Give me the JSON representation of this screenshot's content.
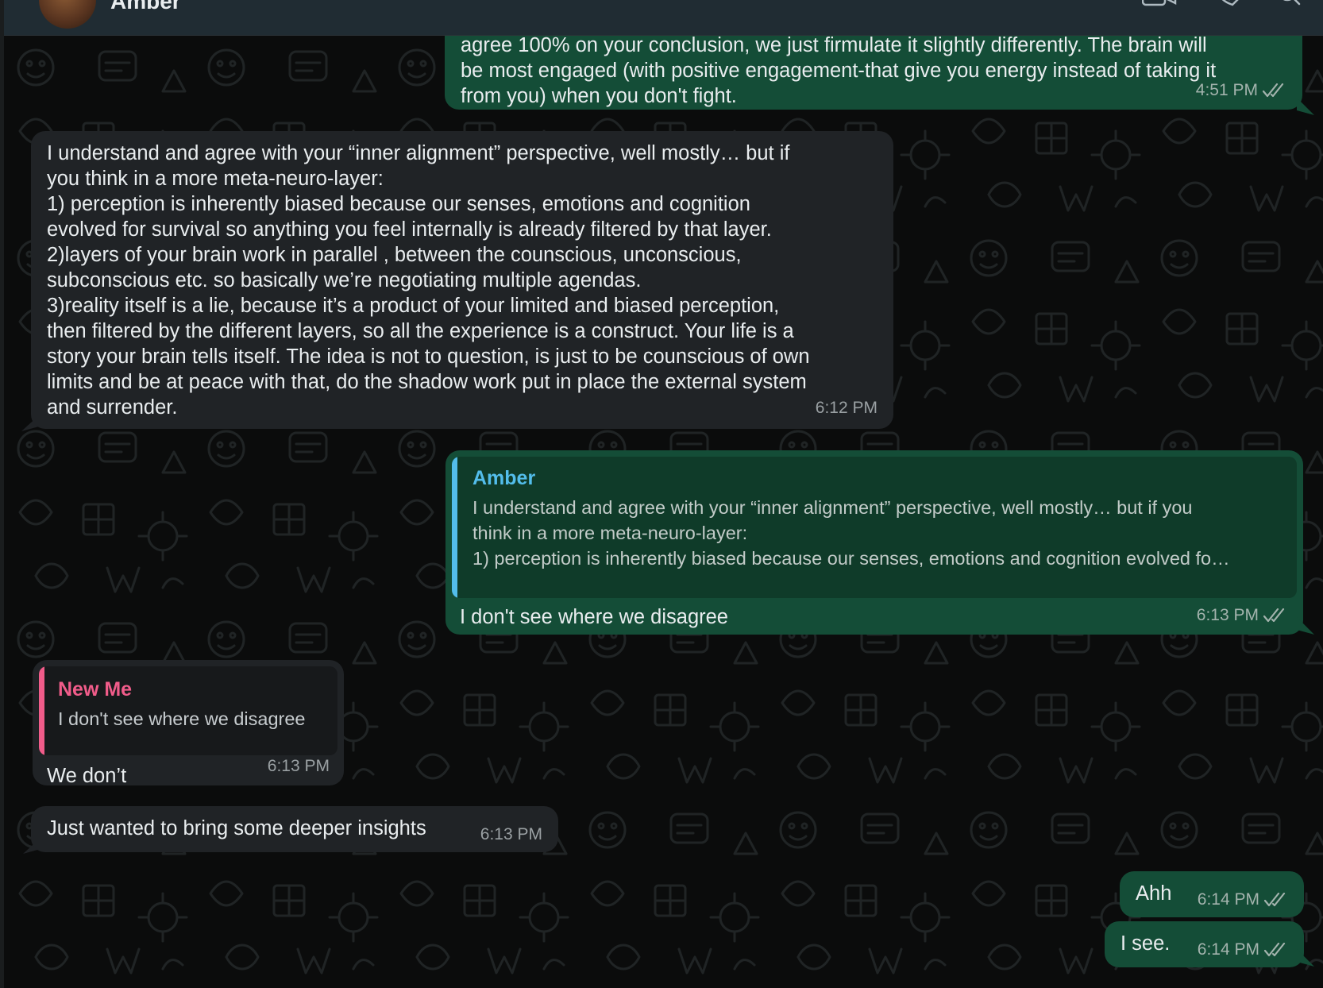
{
  "header": {
    "contact_name": "Amber",
    "icons": [
      "avatar",
      "video-call-icon",
      "voice-call-icon",
      "search-icon"
    ]
  },
  "colors": {
    "incoming_bubble": "#202326",
    "outgoing_bubble": "#144d37",
    "quote_out_bg": "#0f3b29",
    "quote_in_bg": "#17191b",
    "amber_accent": "#53bdeb",
    "newme_accent": "#f15c8a"
  },
  "messages": [
    {
      "direction": "out",
      "text": "agree 100% on your conclusion, we just firmulate it slightly differently. The brain will\nbe most engaged (with positive engagement-that give you energy instead of taking it\nfrom you) when you don't fight.",
      "time": "4:51 PM",
      "read": true
    },
    {
      "direction": "in",
      "text": "I understand and agree with your “inner alignment” perspective, well mostly… but if\nyou think in a more meta-neuro-layer:\n1) perception is inherently biased because our senses, emotions and cognition\nevolved for survival so anything you feel internally is already filtered by that layer.\n2)layers of your brain work in parallel , between the counscious, unconscious,\nsubconscious etc. so basically we’re negotiating multiple agendas.\n3)reality itself is a lie, because it’s a product of your limited and biased perception,\nthen filtered by the different layers, so all the experience is a construct. Your life is a\nstory your brain tells itself. The idea is not to question, is just to be counscious of own\nlimits and be at peace with that, do the shadow work put in place the external system\nand surrender.",
      "time": "6:12 PM"
    },
    {
      "direction": "out",
      "quote": {
        "author": "Amber",
        "text": "I understand and agree with your “inner alignment” perspective, well mostly… but if you\nthink in a more meta-neuro-layer:\n1) perception is inherently biased because our senses, emotions and cognition evolved fo…"
      },
      "text": "I don't see where we disagree",
      "time": "6:13 PM",
      "read": true
    },
    {
      "direction": "in",
      "quote": {
        "author": "New Me",
        "text": "I don't see where we disagree"
      },
      "text": "We don’t",
      "time": "6:13 PM"
    },
    {
      "direction": "in",
      "text": "Just wanted to bring some deeper insights",
      "time": "6:13 PM"
    },
    {
      "direction": "out",
      "text": "Ahh",
      "time": "6:14 PM",
      "read": true
    },
    {
      "direction": "out",
      "text": "I see.",
      "time": "6:14 PM",
      "read": true
    }
  ]
}
